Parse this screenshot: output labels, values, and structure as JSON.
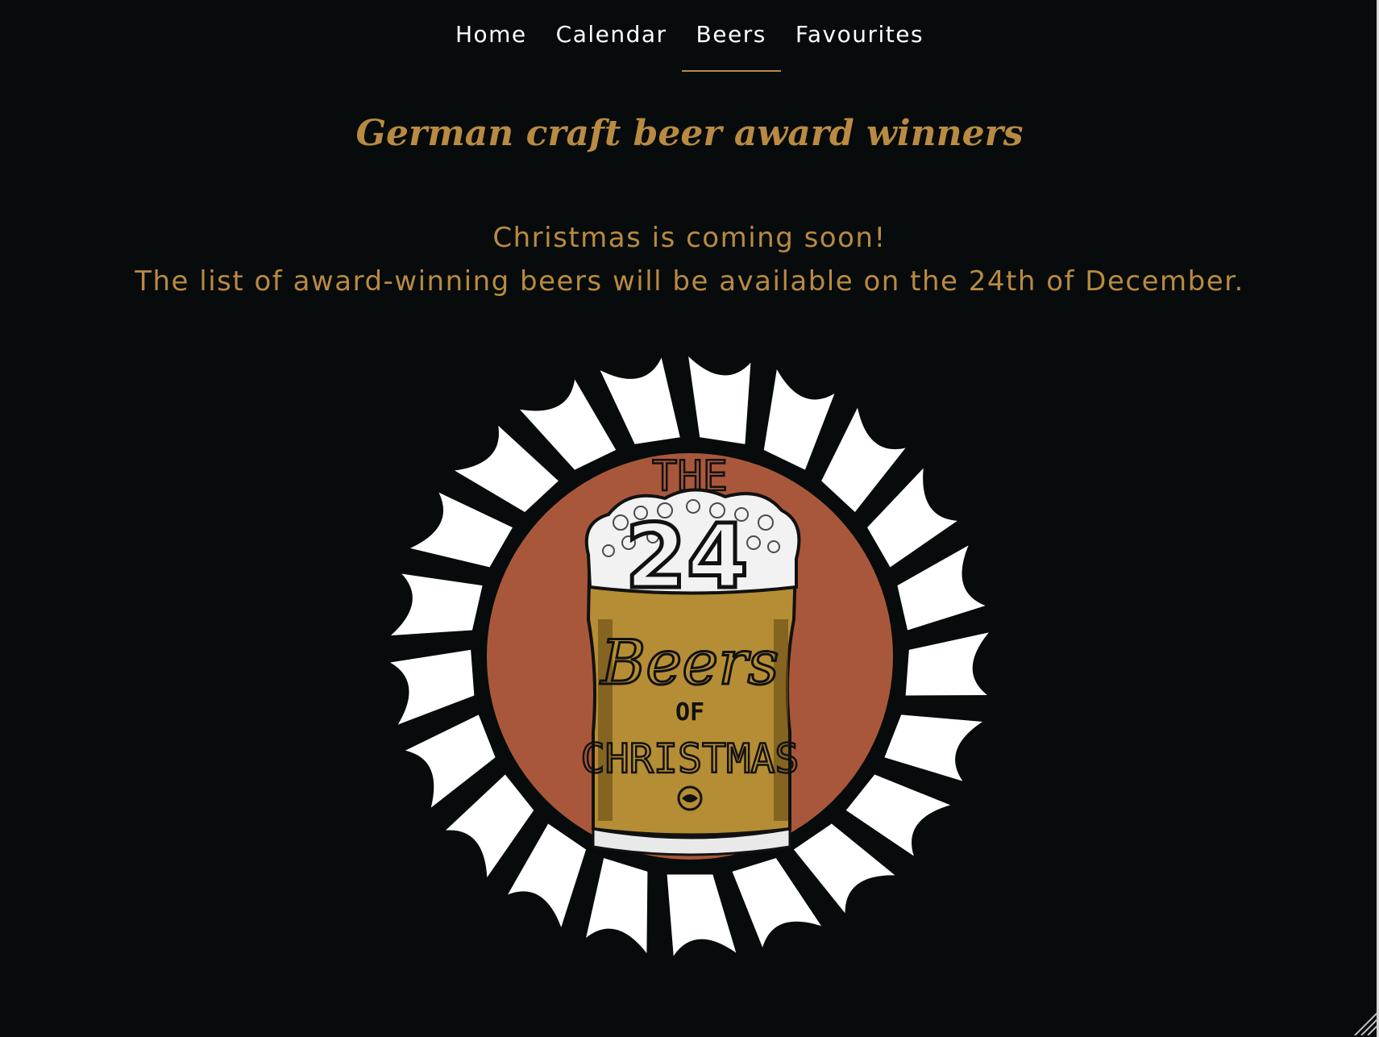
{
  "nav": {
    "items": [
      {
        "label": "Home"
      },
      {
        "label": "Calendar"
      },
      {
        "label": "Beers",
        "active": true
      },
      {
        "label": "Favourites"
      }
    ]
  },
  "page": {
    "title": "German craft beer award winners",
    "message_line1": "Christmas is coming soon!",
    "message_line2": "The list of award-winning beers will be available on the 24th of December."
  },
  "logo": {
    "text_the": "THE",
    "text_number": "24",
    "text_beers": "Beers",
    "text_of": "OF",
    "text_christmas": "CHRISTMAS"
  },
  "colors": {
    "background": "#070b0b",
    "accent": "#b98a42",
    "cap_inner": "#a9573b",
    "cap_teeth": "#ffffff",
    "nav_text": "#ffffff"
  }
}
